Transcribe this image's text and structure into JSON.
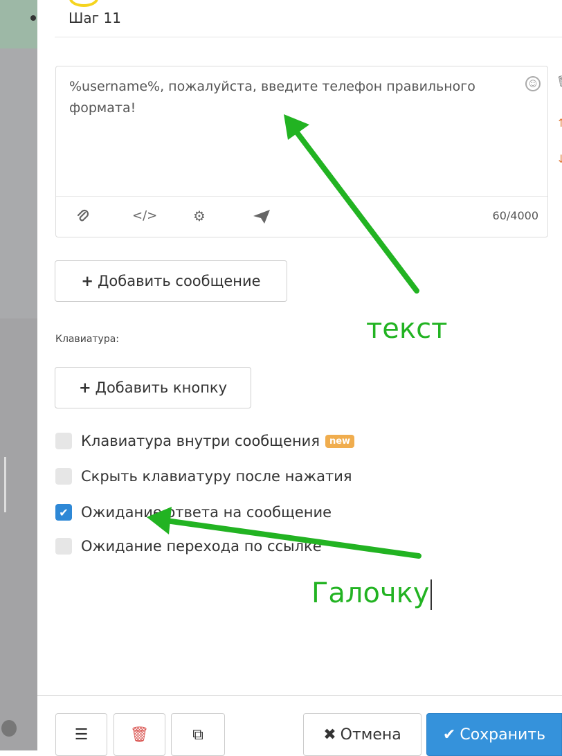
{
  "step": {
    "title": "Шаг 11"
  },
  "editor": {
    "message_text": "%username%, пожалуйста, введите телефон правильного формата!",
    "counter": "60/4000",
    "toolbar_icons": [
      "paperclip-icon",
      "code-icon",
      "gear-icon",
      "send-icon",
      "emoji-icon"
    ]
  },
  "buttons": {
    "add_message": "Добавить сообщение",
    "add_button": "Добавить кнопку",
    "plus": "+"
  },
  "keyboard": {
    "label": "Клавиатура:"
  },
  "options": [
    {
      "label": "Клавиатура внутри сообщения",
      "checked": false,
      "badge": "new"
    },
    {
      "label": "Скрыть клавиатуру после нажатия",
      "checked": false
    },
    {
      "label": "Ожидание ответа на сообщение",
      "checked": true
    },
    {
      "label": "Ожидание перехода по ссылке",
      "checked": false
    }
  ],
  "annotations": {
    "text_note": "текст",
    "check_note": "Галочку",
    "color": "#22b322"
  },
  "footer": {
    "cancel": "Отмена",
    "save": "Сохранить",
    "save_color": "#3592db"
  },
  "colors": {
    "checkbox_checked": "#2e88d6",
    "badge": "#f0ad4e"
  }
}
